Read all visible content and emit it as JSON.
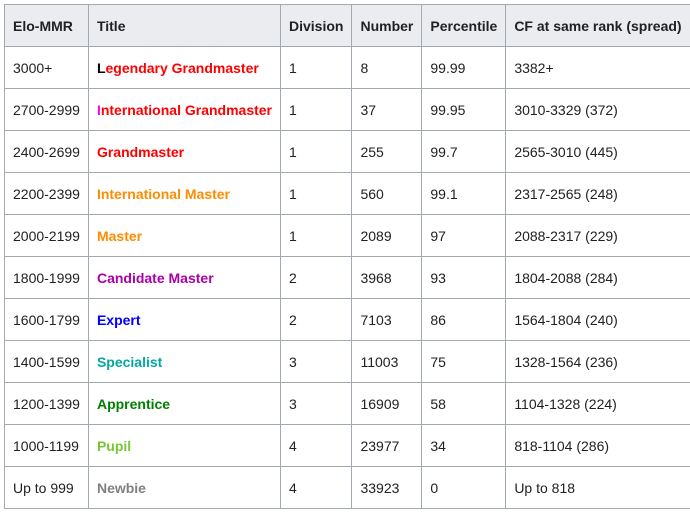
{
  "table": {
    "headers": [
      "Elo-MMR",
      "Title",
      "Division",
      "Number",
      "Percentile",
      "CF at same rank (spread)"
    ],
    "rows": [
      {
        "elo": "3000+",
        "title_first": "L",
        "title_rest": "egendary Grandmaster",
        "first_color": "#000000",
        "color": "#ff0000",
        "division": "1",
        "number": "8",
        "percentile": "99.99",
        "cf": "3382+"
      },
      {
        "elo": "2700-2999",
        "title_first": "I",
        "title_rest": "nternational Grandmaster",
        "first_color": "#ff00ff",
        "color": "#ff0000",
        "division": "1",
        "number": "37",
        "percentile": "99.95",
        "cf": "3010-3329 (372)"
      },
      {
        "elo": "2400-2699",
        "title_first": "",
        "title_rest": "Grandmaster",
        "first_color": "#ff0000",
        "color": "#ff0000",
        "division": "1",
        "number": "255",
        "percentile": "99.7",
        "cf": "2565-3010 (445)"
      },
      {
        "elo": "2200-2399",
        "title_first": "",
        "title_rest": "International Master",
        "first_color": "#ff8c00",
        "color": "#ff8c00",
        "division": "1",
        "number": "560",
        "percentile": "99.1",
        "cf": "2317-2565 (248)"
      },
      {
        "elo": "2000-2199",
        "title_first": "",
        "title_rest": "Master",
        "first_color": "#ff8c00",
        "color": "#ff8c00",
        "division": "1",
        "number": "2089",
        "percentile": "97",
        "cf": "2088-2317 (229)"
      },
      {
        "elo": "1800-1999",
        "title_first": "",
        "title_rest": "Candidate Master",
        "first_color": "#aa00aa",
        "color": "#aa00aa",
        "division": "2",
        "number": "3968",
        "percentile": "93",
        "cf": "1804-2088 (284)"
      },
      {
        "elo": "1600-1799",
        "title_first": "",
        "title_rest": "Expert",
        "first_color": "#0000ff",
        "color": "#0000ff",
        "division": "2",
        "number": "7103",
        "percentile": "86",
        "cf": "1564-1804 (240)"
      },
      {
        "elo": "1400-1599",
        "title_first": "",
        "title_rest": "Specialist",
        "first_color": "#03a89e",
        "color": "#03a89e",
        "division": "3",
        "number": "11003",
        "percentile": "75",
        "cf": "1328-1564 (236)"
      },
      {
        "elo": "1200-1399",
        "title_first": "",
        "title_rest": "Apprentice",
        "first_color": "#008000",
        "color": "#008000",
        "division": "3",
        "number": "16909",
        "percentile": "58",
        "cf": "1104-1328 (224)"
      },
      {
        "elo": "1000-1199",
        "title_first": "",
        "title_rest": "Pupil",
        "first_color": "#77c733",
        "color": "#77c733",
        "division": "4",
        "number": "23977",
        "percentile": "34",
        "cf": "818-1104 (286)"
      },
      {
        "elo": "Up to 999",
        "title_first": "",
        "title_rest": "Newbie",
        "first_color": "#808080",
        "color": "#808080",
        "division": "4",
        "number": "33923",
        "percentile": "0",
        "cf": "Up to 818"
      }
    ]
  }
}
